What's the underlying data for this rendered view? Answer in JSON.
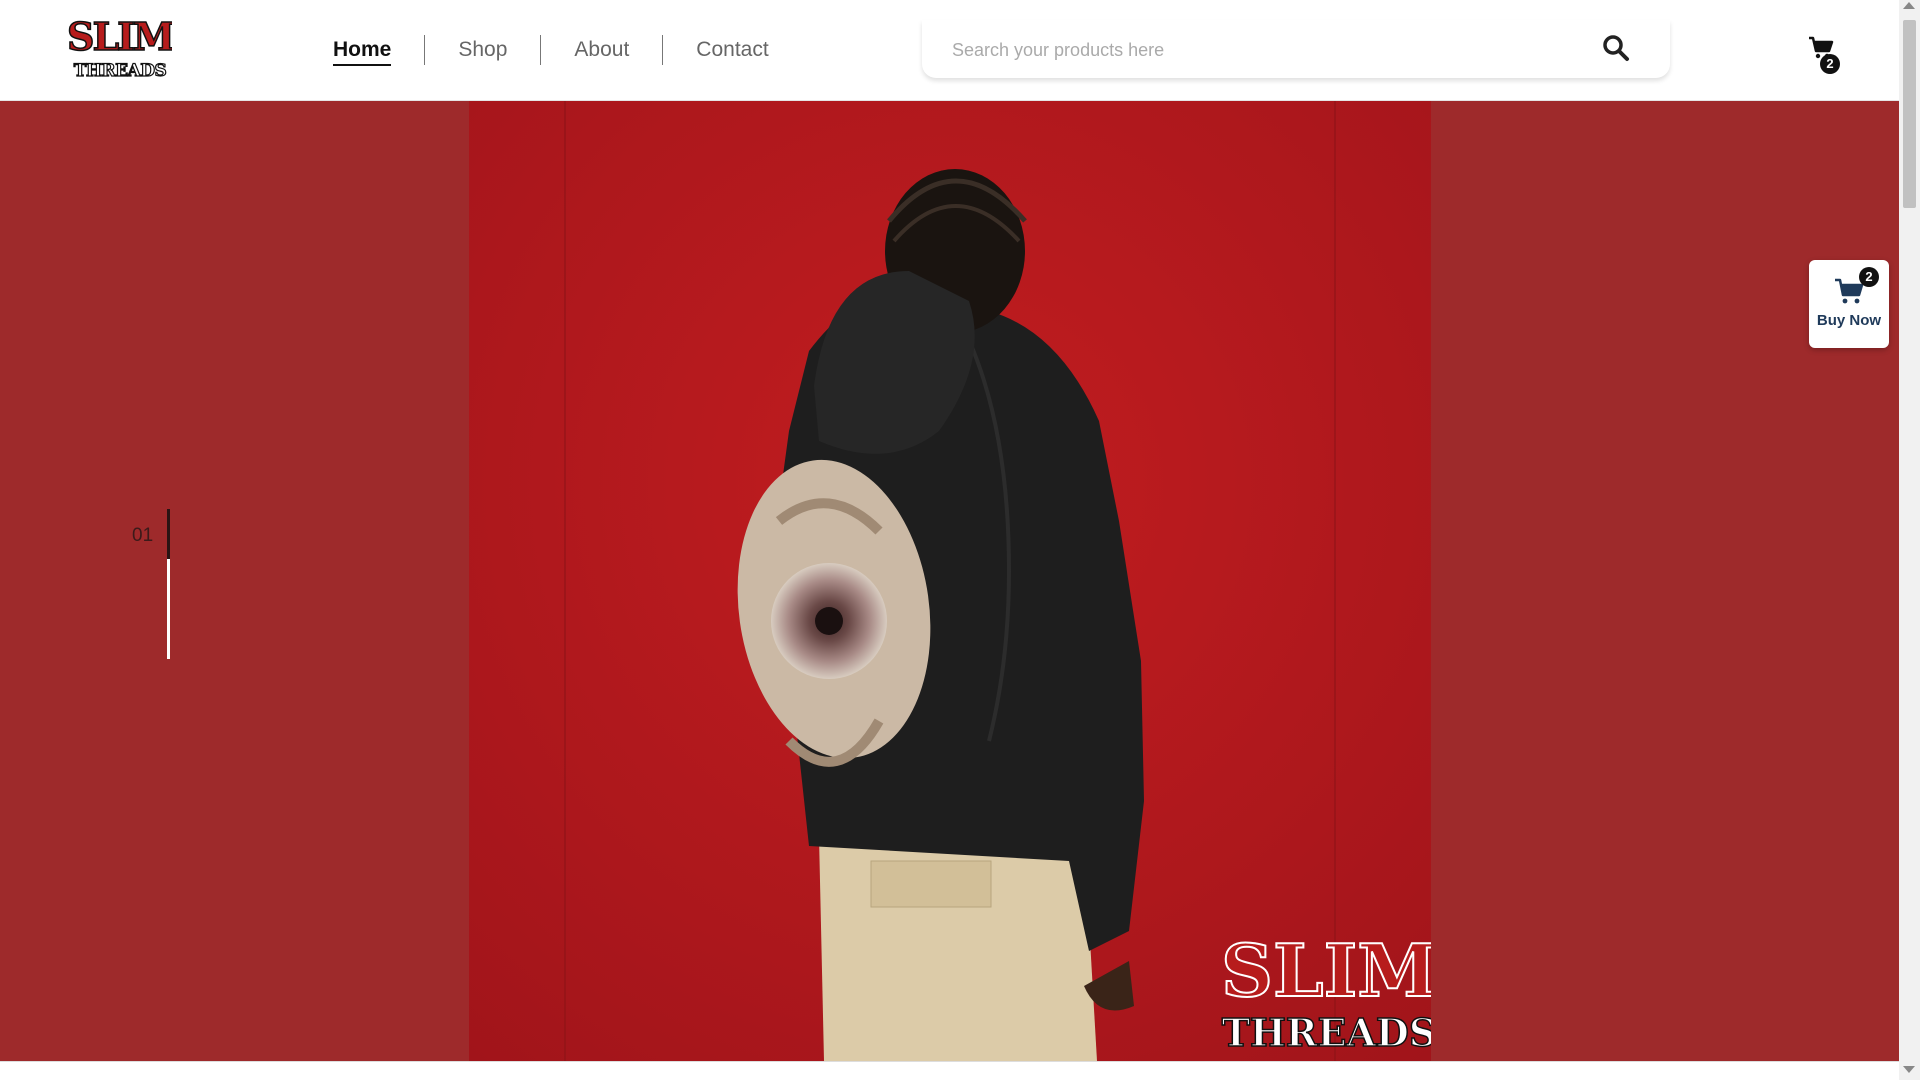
{
  "brand": {
    "logo_line1": "SLIM",
    "logo_line2": "THREADS"
  },
  "nav": {
    "items": [
      "Home",
      "Shop",
      "About",
      "Contact"
    ],
    "active": "Home"
  },
  "search": {
    "placeholder": "Search your products here"
  },
  "cart": {
    "count": "2"
  },
  "hero": {
    "slide_number": "01",
    "background_color": "#9e2a2b",
    "image_bg_color": "#b3161a"
  },
  "buy_now": {
    "label": "Buy Now",
    "count": "2"
  },
  "icons": {
    "search": "search-icon",
    "cart": "cart-icon"
  }
}
